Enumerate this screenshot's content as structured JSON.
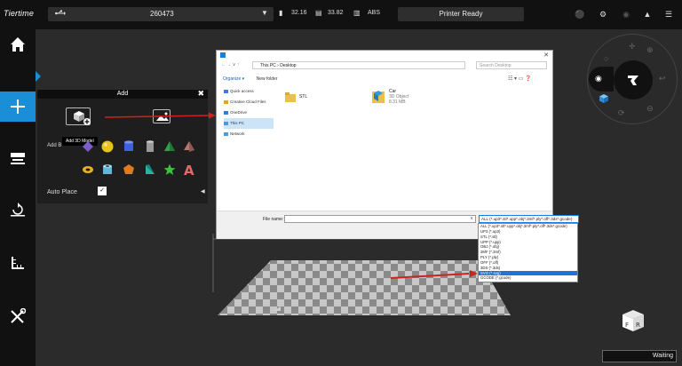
{
  "app": {
    "logo": "Tiertime"
  },
  "topbar": {
    "printer_id": "260473",
    "nozzle_temp": "32.16",
    "bed_temp": "33.82",
    "material": "ABS",
    "status": "Printer Ready"
  },
  "sidebar": {
    "items": [
      {
        "name": "home",
        "icon": "home-icon"
      },
      {
        "name": "add",
        "icon": "plus-icon"
      },
      {
        "name": "print",
        "icon": "print-icon"
      },
      {
        "name": "calibrate",
        "icon": "rotate-icon"
      },
      {
        "name": "measure",
        "icon": "ruler-icon"
      },
      {
        "name": "maintenance",
        "icon": "tools-icon"
      }
    ]
  },
  "add_panel": {
    "title": "Add",
    "tooltip": "Add 3D Model",
    "add_basic_label": "Add B",
    "auto_place_label": "Auto Place",
    "auto_place_checked": "✓"
  },
  "dialog": {
    "breadcrumb": "This PC  ›  Desktop",
    "search_placeholder": "Search Desktop",
    "organize_label": "Organize ▾",
    "new_folder_label": "New folder",
    "nav_items": [
      "Quick access",
      "Creative Cloud Files",
      "OneDrive",
      "This PC",
      "Network"
    ],
    "files": [
      {
        "name": "STL",
        "type": "",
        "size": ""
      },
      {
        "name": "Car",
        "type": "3D Object",
        "size": "8.31 MB"
      }
    ],
    "file_name_label": "File name:",
    "file_name_value": "",
    "filter_selected": "ALL (*.up3*.stl*.upp*.obj*.3mf*.ply*.off*.3ds*.gcode)",
    "filter_options": [
      "ALL (*.up3*.stl*.upp*.obj*.3mf*.ply*.off*.3ds*.gcode)",
      "UP3 (*.up3)",
      "STL (*.stl)",
      "UPP (*.upp)",
      "OBJ (*.obj)",
      "3MF (*.3mf)",
      "PLY (*.ply)",
      "OFF (*.off)",
      "3DS (*.3ds)",
      "SVG (*.svg)",
      "GCODE (*.gcode)"
    ],
    "filter_selected_index": 9
  },
  "bottom_status": "Waiting",
  "colors": {
    "accent": "#1a8fd8",
    "background": "#2b2b2b",
    "sidebar": "#111111",
    "arrow": "#d12020"
  }
}
